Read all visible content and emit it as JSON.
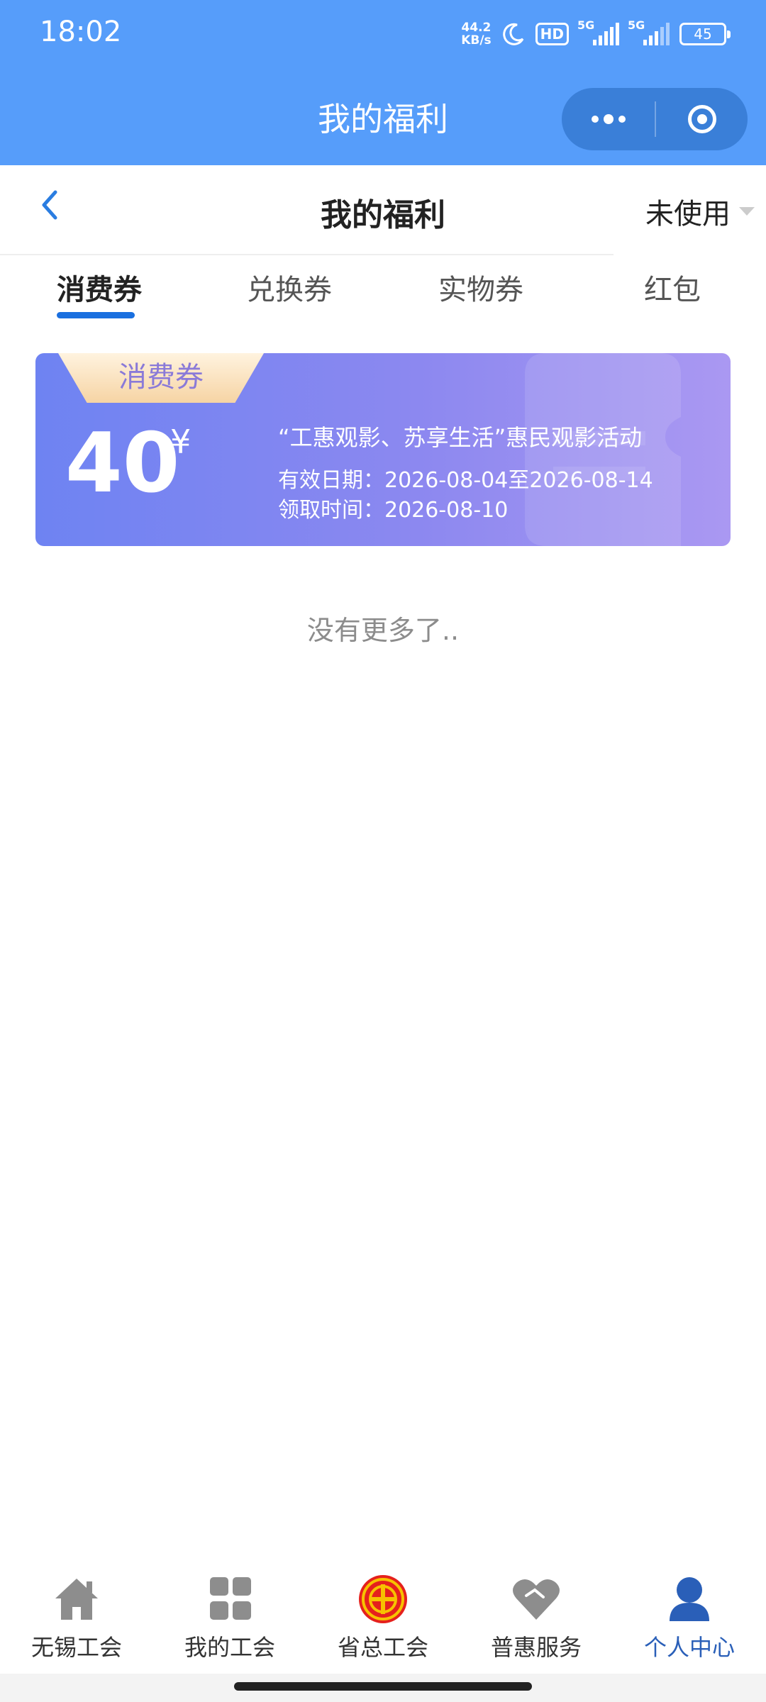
{
  "status_bar": {
    "time": "18:02",
    "net_speed_value": "44.2",
    "net_speed_unit": "KB/s",
    "hd_label": "HD",
    "signal1_label": "5G",
    "signal2_label": "5G",
    "battery": "45"
  },
  "mini_program": {
    "title": "我的福利"
  },
  "header": {
    "title": "我的福利",
    "filter_label": "未使用"
  },
  "tabs": [
    {
      "label": "消费券",
      "active": true
    },
    {
      "label": "兑换券",
      "active": false
    },
    {
      "label": "实物券",
      "active": false
    },
    {
      "label": "红包",
      "active": false
    }
  ],
  "coupons": [
    {
      "tag": "消费券",
      "value": "40",
      "currency": "¥",
      "name": "“工惠观影、苏享生活”惠民观影活动",
      "valid": "有效日期：2026-08-04至2026-08-14",
      "received": "领取时间：2026-08-10"
    }
  ],
  "list_end_text": "没有更多了..",
  "bottom_nav": [
    {
      "label": "无锡工会",
      "icon": "home-icon"
    },
    {
      "label": "我的工会",
      "icon": "grid-icon"
    },
    {
      "label": "省总工会",
      "icon": "union-emblem-icon"
    },
    {
      "label": "普惠服务",
      "icon": "heart-icon"
    },
    {
      "label": "个人中心",
      "icon": "person-icon",
      "active": true
    }
  ],
  "colors": {
    "top_bar": "#569dfa",
    "accent": "#1a6fdf",
    "nav_active": "#2a5fb8",
    "coupon_start": "#6e83f2",
    "coupon_end": "#aa98f2"
  }
}
